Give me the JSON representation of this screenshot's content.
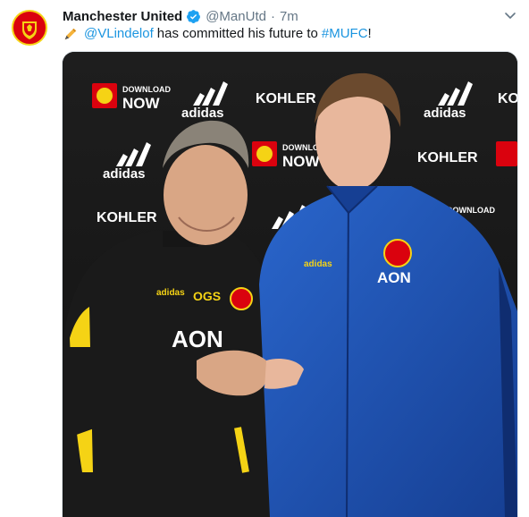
{
  "tweet": {
    "author_name": "Manchester United",
    "author_handle": "@ManUtd",
    "separator": "·",
    "timestamp": "7m",
    "text_mention": "@VLindelof",
    "text_body": "has committed his future to",
    "text_hashtag": "#MUFC",
    "text_end": "!"
  },
  "backdrop": {
    "sponsor_kohler": "KOHLER",
    "sponsor_adidas": "adidas",
    "download": "DOWNLOAD",
    "now": "NOW"
  },
  "colors": {
    "link": "#1b95e0",
    "verified": "#1da1f2",
    "utd_red": "#da020e",
    "kit_blue": "#1d56b8",
    "kit_black": "#1a1a1a",
    "kit_yellow": "#f5d315"
  },
  "icons": [
    "club-crest-icon",
    "verified-badge-icon",
    "chevron-down-icon",
    "pen-emoji-icon"
  ]
}
